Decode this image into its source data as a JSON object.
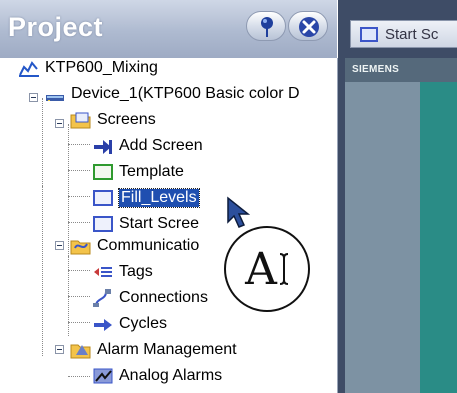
{
  "panel": {
    "title": "Project",
    "pin_icon": "pin-icon",
    "close_icon": "close-icon"
  },
  "tree": {
    "root": "KTP600_Mixing",
    "device": "Device_1(KTP600 Basic color D",
    "screens": "Screens",
    "add_screen": "Add Screen",
    "template": "Template",
    "fill_levels": "Fill_Levels",
    "start_screen": "Start Scree",
    "communication": "Communicatio",
    "tags": "Tags",
    "connections": "Connections",
    "cycles": "Cycles",
    "alarm_management": "Alarm Management",
    "analog_alarms": "Analog Alarms"
  },
  "editor": {
    "tab_label": "Start Sc",
    "brand": "SIEMENS"
  },
  "badge": {
    "text": "A"
  },
  "colors": {
    "selection": "#1f4fb0",
    "header_gradient": "#aebad0",
    "editor_bg": "#3e4c66",
    "hmi_display": "#2a8c86"
  }
}
